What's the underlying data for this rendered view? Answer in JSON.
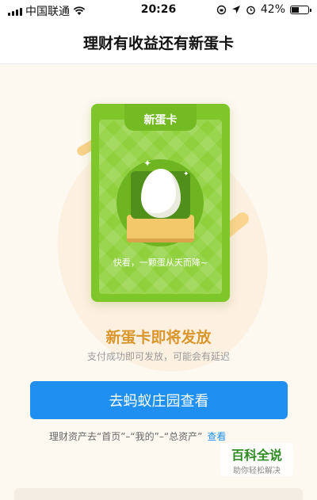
{
  "status_bar": {
    "carrier": "中国联通",
    "time": "20:26",
    "battery": "42%"
  },
  "nav": {
    "title": "理财有收益还有新蛋卡"
  },
  "card": {
    "title": "新蛋卡",
    "slogan": "快看，一颗蛋从天而降~"
  },
  "main": {
    "headline": "新蛋卡即将发放",
    "subline": "支付成功即可发放，可能会有延迟",
    "button_label": "去蚂蚁庄园查看",
    "hint_text": "理财资产去“首页”–“我的”–“总资产”",
    "hint_link": "查看"
  },
  "watermark": {
    "title": "百科全说",
    "subtitle": "助你轻松解决"
  },
  "colors": {
    "accent_blue": "#1f8ff0",
    "card_green": "#7ec62a",
    "headline_gold": "#d9962c"
  }
}
